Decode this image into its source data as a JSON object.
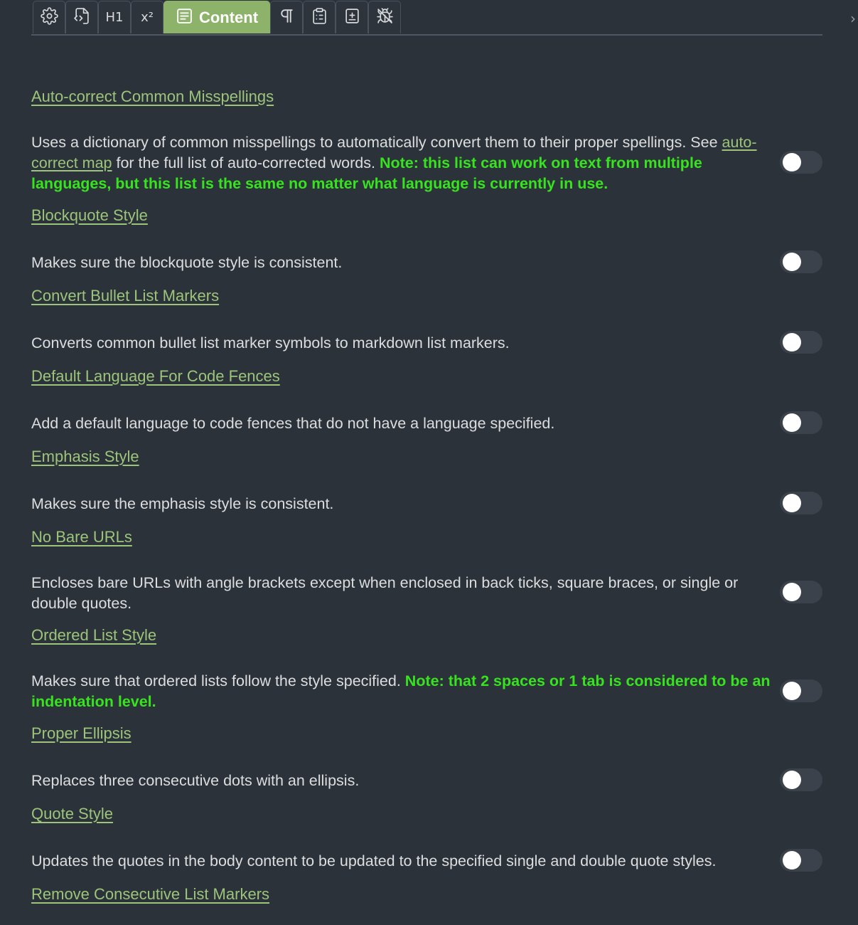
{
  "tabs": [
    {
      "icon": "gear-icon"
    },
    {
      "icon": "file-code-icon"
    },
    {
      "icon": "heading-icon",
      "text": "H1"
    },
    {
      "icon": "superscript-icon",
      "text": "x²"
    },
    {
      "icon": "content-icon",
      "label": "Content"
    },
    {
      "icon": "pilcrow-icon"
    },
    {
      "icon": "clipboard-list-icon"
    },
    {
      "icon": "add-file-icon"
    },
    {
      "icon": "debug-icon"
    }
  ],
  "colors": {
    "background": "#2c323a",
    "accent": "#8db36a",
    "link": "#9cc47a",
    "note": "#37e31f"
  },
  "settings": [
    {
      "title": "Auto-correct Common Misspellings",
      "desc_pre": "Uses a dictionary of common misspellings to automatically convert them to their proper spellings. See ",
      "desc_link": "auto-correct map",
      "desc_post": " for the full list of auto-corrected words. ",
      "note": "Note: this list can work on text from multiple languages, but this list is the same no matter what language is currently in use.",
      "enabled": false
    },
    {
      "title": "Blockquote Style",
      "desc": "Makes sure the blockquote style is consistent.",
      "enabled": false
    },
    {
      "title": "Convert Bullet List Markers",
      "desc": "Converts common bullet list marker symbols to markdown list markers.",
      "enabled": false
    },
    {
      "title": "Default Language For Code Fences",
      "desc": "Add a default language to code fences that do not have a language specified.",
      "enabled": false
    },
    {
      "title": "Emphasis Style",
      "desc": "Makes sure the emphasis style is consistent.",
      "enabled": false
    },
    {
      "title": "No Bare URLs",
      "desc": "Encloses bare URLs with angle brackets except when enclosed in back ticks, square braces, or single or double quotes.",
      "enabled": false
    },
    {
      "title": "Ordered List Style",
      "desc": "Makes sure that ordered lists follow the style specified. ",
      "note": "Note: that 2 spaces or 1 tab is considered to be an indentation level.",
      "enabled": false
    },
    {
      "title": "Proper Ellipsis",
      "desc": "Replaces three consecutive dots with an ellipsis.",
      "enabled": false
    },
    {
      "title": "Quote Style",
      "desc": "Updates the quotes in the body content to be updated to the specified single and double quote styles.",
      "enabled": false
    },
    {
      "title": "Remove Consecutive List Markers"
    }
  ]
}
